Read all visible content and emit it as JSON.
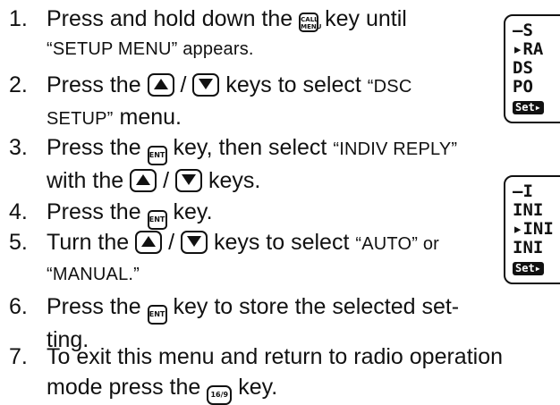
{
  "steps": [
    {
      "num": "1.",
      "t1": "Press and hold down the",
      "key": "CALL MENU",
      "t2": "key until",
      "q": "“SETUP MENU” appears."
    },
    {
      "num": "2.",
      "t1": "Press the",
      "t2": "keys to select",
      "q1": "“DSC",
      "q2": "SETUP”",
      "t3": "menu."
    },
    {
      "num": "3.",
      "t1": "Press the",
      "key": "ENT",
      "t2": "key, then select",
      "q": "“INDIV REPLY”",
      "t3": "with the",
      "t4": "keys."
    },
    {
      "num": "4.",
      "t1": "Press the",
      "key": "ENT",
      "t2": "key."
    },
    {
      "num": "5.",
      "t1": "Turn the",
      "t2": "keys to select",
      "q1": "“AUTO” or",
      "q2": "“MANUAL.”"
    },
    {
      "num": "6.",
      "t1": "Press the",
      "key": "ENT",
      "t2": "key to store the selected set-",
      "t3": "ting."
    },
    {
      "num": "7.",
      "t1": "To exit this menu and return to radio operation",
      "t2": "mode press the",
      "key": "16/9",
      "t3": "key."
    }
  ],
  "slash": "/",
  "lcd1": {
    "l1": "—S",
    "l2": "▸RA",
    "l3": "DS",
    "l4": "PO",
    "set": "Set▸"
  },
  "lcd2": {
    "l1": "—I",
    "l2": "INI",
    "l3": "▸INI",
    "l4": "INI",
    "set": "Set▸"
  }
}
